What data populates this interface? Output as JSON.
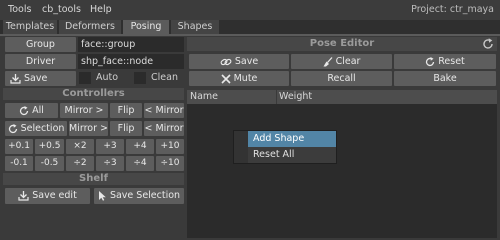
{
  "menubar": {
    "items": [
      "Tools",
      "cb_tools",
      "Help"
    ],
    "project": "Project: ctr_maya"
  },
  "tabs": [
    "Templates",
    "Deformers",
    "Posing",
    "Shapes"
  ],
  "active_tab": "Posing",
  "top": {
    "group_label": "Group",
    "group_value": "face::group",
    "driver_label": "Driver",
    "driver_value": "shp_face::node",
    "save_mods": "Save mods",
    "auto": "Auto",
    "clean": "Clean"
  },
  "controllers": {
    "title": "Controllers",
    "all": "All",
    "mirror_r": "Mirror >",
    "flip": "Flip",
    "mirror_l": "< Mirror",
    "selection": "Selection",
    "row1": [
      "+0.1",
      "+0.5",
      "×2",
      "+3",
      "+4",
      "+10"
    ],
    "row2": [
      "-0.1",
      "-0.5",
      "÷2",
      "÷3",
      "÷4",
      "÷10"
    ]
  },
  "shelf": {
    "title": "Shelf",
    "save_edit": "Save edit",
    "save_selection": "Save Selection"
  },
  "pose_editor": {
    "title": "Pose Editor",
    "save": "Save",
    "clear": "Clear",
    "reset": "Reset",
    "mute": "Mute",
    "recall": "Recall",
    "bake": "Bake",
    "col_name": "Name",
    "col_weight": "Weight"
  },
  "context_menu": {
    "items": [
      "Add Shape",
      "Reset All"
    ],
    "highlighted": "Add Shape"
  },
  "colors": {
    "accent": "#5285a6",
    "button": "#5d5d5d",
    "field": "#2b2b2b",
    "panel": "#3a3a3a"
  }
}
